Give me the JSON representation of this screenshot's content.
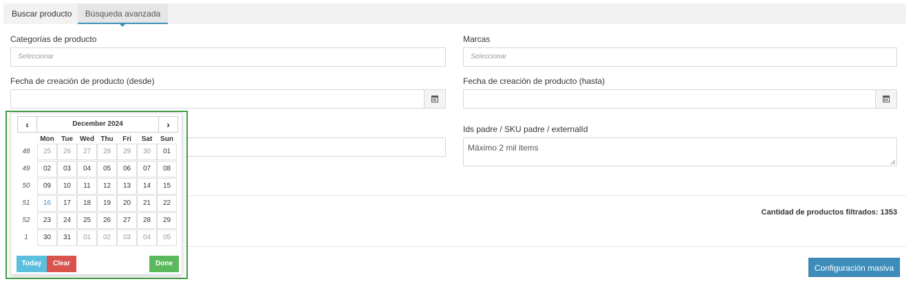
{
  "tabs": [
    {
      "label": "Buscar producto"
    },
    {
      "label": "Búsqueda avanzada"
    }
  ],
  "form": {
    "categorias": {
      "label": "Categorías de producto",
      "placeholder": "Seleccionar"
    },
    "marcas": {
      "label": "Marcas",
      "placeholder": "Seleccionar"
    },
    "fecha_desde": {
      "label": "Fecha de creación de producto (desde)",
      "value": ""
    },
    "fecha_hasta": {
      "label": "Fecha de creación de producto (hasta)",
      "value": ""
    },
    "ids_padre": {
      "label": "Ids padre / SKU padre / externalId",
      "placeholder": "Máximo 2 mil items"
    }
  },
  "summary": {
    "label": "Cantidad de productos filtrados:",
    "value": "1353"
  },
  "actions": {
    "configuracion_masiva": "Configuración masiva"
  },
  "datepicker": {
    "month": "December 2024",
    "weekdays": [
      "Mon",
      "Tue",
      "Wed",
      "Thu",
      "Fri",
      "Sat",
      "Sun"
    ],
    "weeks": [
      {
        "num": "48",
        "days": [
          [
            "25",
            true
          ],
          [
            "26",
            true
          ],
          [
            "27",
            true
          ],
          [
            "28",
            true
          ],
          [
            "29",
            true
          ],
          [
            "30",
            true
          ],
          [
            "01",
            false
          ]
        ]
      },
      {
        "num": "49",
        "days": [
          [
            "02",
            false
          ],
          [
            "03",
            false
          ],
          [
            "04",
            false
          ],
          [
            "05",
            false
          ],
          [
            "06",
            false
          ],
          [
            "07",
            false
          ],
          [
            "08",
            false
          ]
        ]
      },
      {
        "num": "50",
        "days": [
          [
            "09",
            false
          ],
          [
            "10",
            false
          ],
          [
            "11",
            false
          ],
          [
            "12",
            false
          ],
          [
            "13",
            false
          ],
          [
            "14",
            false
          ],
          [
            "15",
            false
          ]
        ]
      },
      {
        "num": "51",
        "days": [
          [
            "16",
            false
          ],
          [
            "17",
            false
          ],
          [
            "18",
            false
          ],
          [
            "19",
            false
          ],
          [
            "20",
            false
          ],
          [
            "21",
            false
          ],
          [
            "22",
            false
          ]
        ]
      },
      {
        "num": "52",
        "days": [
          [
            "23",
            false
          ],
          [
            "24",
            false
          ],
          [
            "25",
            false
          ],
          [
            "26",
            false
          ],
          [
            "27",
            false
          ],
          [
            "28",
            false
          ],
          [
            "29",
            false
          ]
        ]
      },
      {
        "num": "1",
        "days": [
          [
            "30",
            false
          ],
          [
            "31",
            false
          ],
          [
            "01",
            true
          ],
          [
            "02",
            true
          ],
          [
            "03",
            true
          ],
          [
            "04",
            true
          ],
          [
            "05",
            true
          ]
        ]
      }
    ],
    "today_day": "16",
    "buttons": {
      "today": "Today",
      "clear": "Clear",
      "done": "Done"
    },
    "colors": {
      "today": "#5bc0de",
      "clear": "#d9534f",
      "done": "#5cb85c",
      "highlight": "#3c8dbc"
    }
  }
}
